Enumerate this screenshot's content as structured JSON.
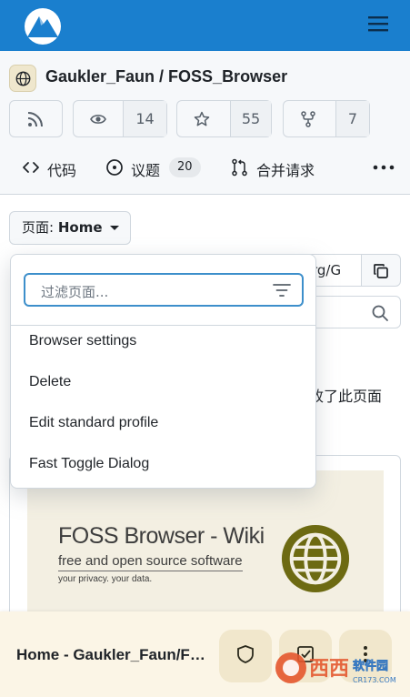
{
  "colors": {
    "accent": "#1a7fce",
    "focus": "#3d8fcb",
    "bottom_bar": "#fbf5e6"
  },
  "topbar": {
    "logo_icon": "mountain-logo-icon",
    "menu_icon": "hamburger-menu-icon"
  },
  "repo": {
    "avatar_icon": "globe-icon",
    "title": "Gaukler_Faun / FOSS_Browser",
    "rss_icon": "rss-icon",
    "watch_icon": "eye-icon",
    "watch_count": "14",
    "star_icon": "star-icon",
    "star_count": "55",
    "fork_icon": "fork-icon",
    "fork_count": "7"
  },
  "tabs": [
    {
      "label": "代码",
      "icon": "code-icon"
    },
    {
      "label": "议题",
      "icon": "issue-icon",
      "badge": "20"
    },
    {
      "label": "合并请求",
      "icon": "pull-request-icon"
    }
  ],
  "more_icon": "more-horizontal-icon",
  "page_selector": {
    "prefix": "页面:",
    "value": "Home"
  },
  "clone": {
    "url_fragment": "rg/G",
    "copy_icon": "copy-icon"
  },
  "search": {
    "icon": "search-icon"
  },
  "edit_note": "改了此页面",
  "dropdown": {
    "placeholder": "过滤页面...",
    "filter_icon": "filter-icon",
    "items": [
      "Browser settings",
      "Delete",
      "Edit standard profile",
      "Fast Toggle Dialog"
    ]
  },
  "wiki_banner": {
    "title": "FOSS Browser - Wiki",
    "subtitle": "free and open source software",
    "tagline": "your privacy.  your data."
  },
  "bottom": {
    "title": "Home - Gaukler_Faun/FOSS_Browser",
    "buttons": [
      "shield-icon",
      "checklist-icon",
      "more-vertical-icon"
    ]
  },
  "watermark": {
    "text": "西西",
    "subtext": "软件园",
    "site": "CR173.COM"
  }
}
